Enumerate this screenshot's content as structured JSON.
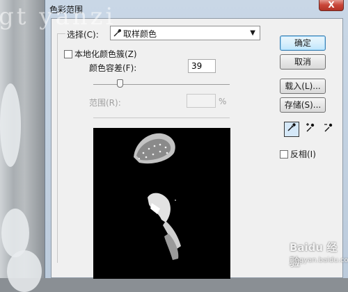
{
  "window": {
    "title": "色彩范围",
    "close": "X"
  },
  "watermark": {
    "top": "gt yanzi",
    "baidu": "Baidu 经验",
    "url": "jingyan.baidu.com"
  },
  "select": {
    "label": "选择(C):",
    "value": "取样颜色"
  },
  "localized": {
    "label": "本地化颜色簇(Z)"
  },
  "fuzziness": {
    "label": "颜色容差(F):",
    "value": "39"
  },
  "range": {
    "label": "范围(R):",
    "unit": "%"
  },
  "buttons": {
    "ok": "确定",
    "cancel": "取消",
    "load": "载入(L)...",
    "save": "存储(S)..."
  },
  "invert": {
    "label": "反相(I)"
  },
  "icons": {
    "eyedropper": "eyedropper-icon",
    "eyedropper_plus": "eyedropper-plus-icon",
    "eyedropper_minus": "eyedropper-minus-icon"
  }
}
